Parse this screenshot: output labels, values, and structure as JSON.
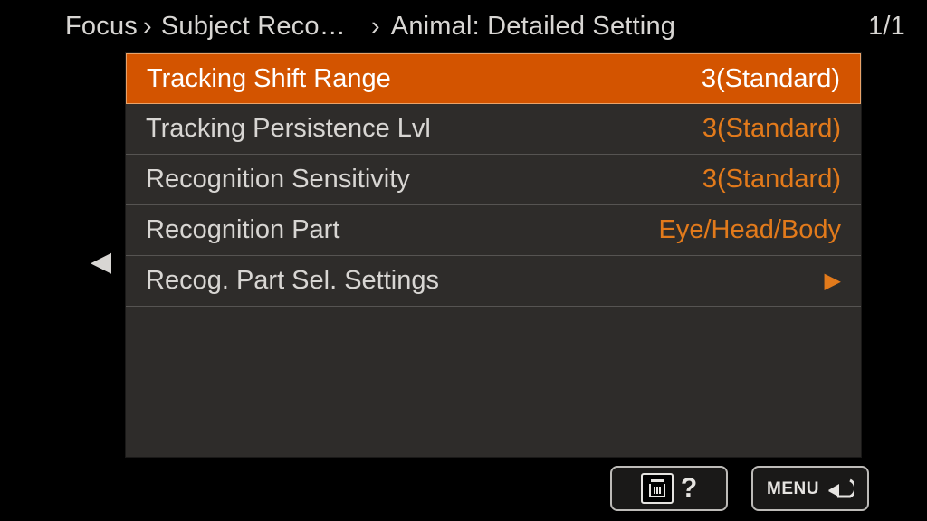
{
  "breadcrumb": {
    "root": "Focus",
    "mid": "Subject Reco…",
    "leaf": "Animal: Detailed Setting"
  },
  "page": "1/1",
  "menu": {
    "items": [
      {
        "label": "Tracking Shift Range",
        "value": "3(Standard)",
        "selected": true,
        "hasArrow": false
      },
      {
        "label": "Tracking Persistence Lvl",
        "value": "3(Standard)",
        "selected": false,
        "hasArrow": false
      },
      {
        "label": "Recognition Sensitivity",
        "value": "3(Standard)",
        "selected": false,
        "hasArrow": false
      },
      {
        "label": "Recognition Part",
        "value": "Eye/Head/Body",
        "selected": false,
        "hasArrow": false
      },
      {
        "label": "Recog. Part Sel. Settings",
        "value": "",
        "selected": false,
        "hasArrow": true
      }
    ]
  },
  "buttons": {
    "help": "?",
    "menu": "MENU"
  }
}
